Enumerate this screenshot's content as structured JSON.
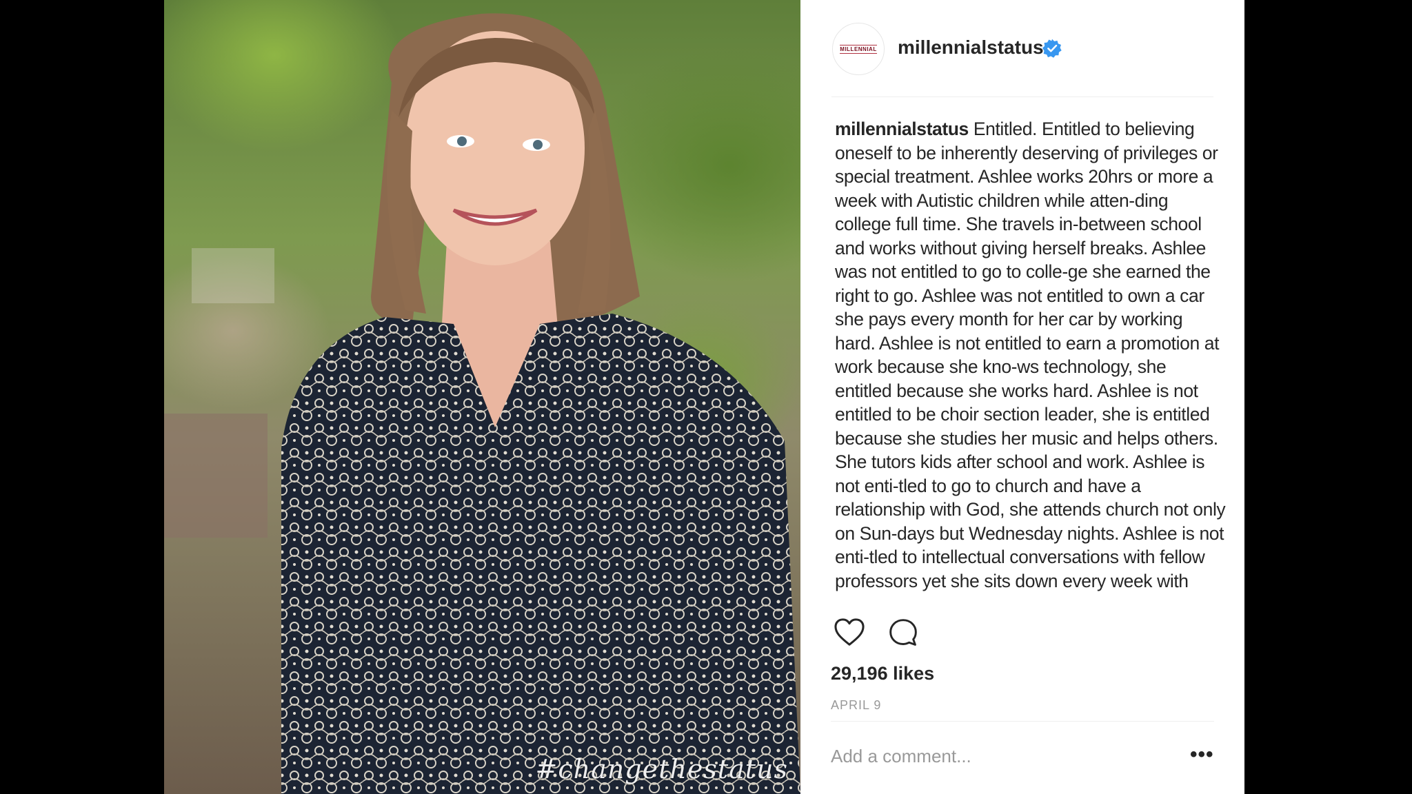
{
  "photo": {
    "watermark": "#changethestatus",
    "alt": "photo"
  },
  "post": {
    "avatar_text": "MILLENNIAL",
    "username": "millennialstatus",
    "verified_icon": "verified-badge-icon",
    "caption_user": "millennialstatus",
    "caption_text": "Entitled. Entitled to believing oneself to be inherently deserving of privileges or special treatment. Ashlee works 20hrs or more a week with Autistic children while atten-ding college full time. She travels in-between school and works without giving herself breaks. Ashlee was not entitled to go to colle-ge she earned the right to go. Ashlee was not entitled to own a car she pays every month for her car by working hard. Ashlee is not entitled to earn a promotion at work because she kno-ws technology, she entitled because she works hard. Ashlee is not entitled to be choir section leader, she is entitled because she studies her music and helps others.  She tutors kids after school and work. Ashlee is not enti-tled to go to church and have a relationship with God, she attends church not only on Sun-days but Wednesday nights. Ashlee is not enti-tled to intellectual conversations with fellow professors yet she sits down every week with",
    "likes": "29,196 likes",
    "date": "APRIL 9",
    "comment_placeholder": "Add a comment...",
    "more_label": "•••"
  },
  "colors": {
    "verified": "#3897f0",
    "text": "#262626",
    "muted": "#999999"
  }
}
